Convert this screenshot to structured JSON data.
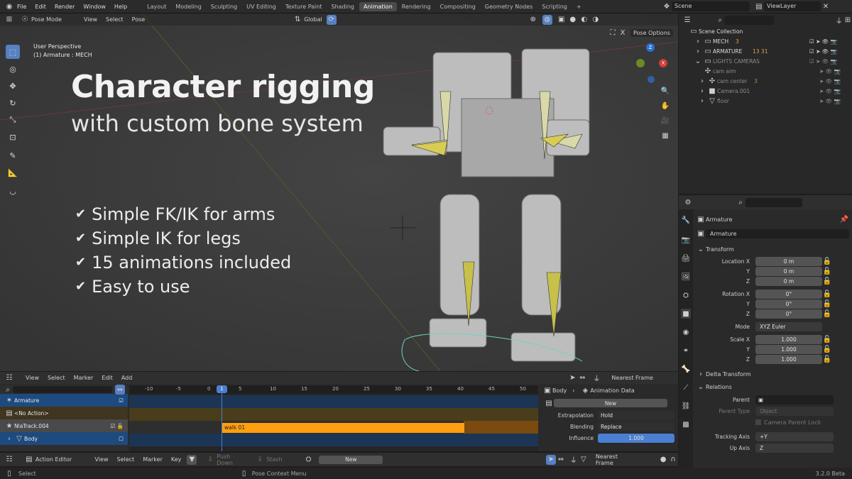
{
  "topbar": {
    "menus": [
      "File",
      "Edit",
      "Render",
      "Window",
      "Help"
    ],
    "workspaces": [
      "Layout",
      "Modeling",
      "Sculpting",
      "UV Editing",
      "Texture Paint",
      "Shading",
      "Animation",
      "Rendering",
      "Compositing",
      "Geometry Nodes",
      "Scripting"
    ],
    "active_workspace": "Animation",
    "scene_label": "Scene",
    "viewlayer_label": "ViewLayer"
  },
  "viewport": {
    "mode": "Pose Mode",
    "menus": [
      "View",
      "Select",
      "Pose"
    ],
    "orientation": "Global",
    "pose_options": "Pose Options",
    "perspective": "User Perspective",
    "object_info": "(1) Armature : MECH",
    "headline": "Character rigging",
    "subheadline": "with custom bone system",
    "features": [
      "Simple FK/IK for arms",
      "Simple IK for legs",
      "15 animations included",
      "Easy to use"
    ],
    "axis_z": "Z",
    "axis_x": "X"
  },
  "outliner": {
    "title": "Scene Collection",
    "items": [
      {
        "name": "MECH",
        "extra": "3",
        "dim": false
      },
      {
        "name": "ARMATURE",
        "extra": "13  31",
        "dim": false
      },
      {
        "name": "LIGHTS CAMERAS",
        "extra": "",
        "dim": true
      },
      {
        "name": "cam aim",
        "extra": "",
        "dim": true
      },
      {
        "name": "cam center",
        "extra": "3",
        "dim": true
      },
      {
        "name": "Camera.001",
        "extra": "",
        "dim": true
      },
      {
        "name": "floor",
        "extra": "",
        "dim": true
      }
    ]
  },
  "properties": {
    "object_name": "Armature",
    "data_name": "Armature",
    "transform_title": "Transform",
    "location": {
      "label": "Location X",
      "x": "0 m",
      "y": "0 m",
      "z": "0 m"
    },
    "rotation": {
      "label": "Rotation X",
      "x": "0°",
      "y": "0°",
      "z": "0°"
    },
    "mode_label": "Mode",
    "mode_value": "XYZ Euler",
    "scale": {
      "label": "Scale X",
      "x": "1.000",
      "y": "1.000",
      "z": "1.000"
    },
    "axis_y": "Y",
    "axis_z": "Z",
    "delta_title": "Delta Transform",
    "relations_title": "Relations",
    "parent_label": "Parent",
    "parent_type_label": "Parent Type",
    "parent_type_value": "Object",
    "camera_parent_lock": "Camera Parent Lock",
    "tracking_axis_label": "Tracking Axis",
    "tracking_axis_value": "+Y",
    "up_axis_label": "Up Axis",
    "up_axis_value": "Z"
  },
  "nla": {
    "menus": [
      "View",
      "Select",
      "Marker",
      "Edit",
      "Add"
    ],
    "snap": "Nearest Frame",
    "frames": [
      "-10",
      "-5",
      "0",
      "5",
      "10",
      "15",
      "20",
      "25",
      "30",
      "35",
      "40",
      "45",
      "50"
    ],
    "current_frame": "1",
    "tracks": [
      {
        "name": "Armature",
        "kind": "object"
      },
      {
        "name": "<No Action>",
        "kind": "action"
      },
      {
        "name": "NlaTrack.004",
        "kind": "track"
      },
      {
        "name": "Body",
        "kind": "object"
      }
    ],
    "strip_name": "walk 01",
    "side": {
      "path_body": "Body",
      "path_anim": "Animation Data",
      "new_label": "New",
      "extrapolation_label": "Extrapolation",
      "extrapolation_value": "Hold",
      "blending_label": "Blending",
      "blending_value": "Replace",
      "influence_label": "Influence",
      "influence_value": "1.000"
    }
  },
  "action_editor": {
    "mode": "Action Editor",
    "menus": [
      "View",
      "Select",
      "Marker",
      "Key"
    ],
    "push_down": "Push Down",
    "stash": "Stash",
    "new_label": "New",
    "snap": "Nearest Frame"
  },
  "status": {
    "select": "Select",
    "context": "Pose Context Menu",
    "version": "3.2.0 Beta"
  },
  "colors": {
    "accent": "#5680c2",
    "strip": "#ff9f10",
    "track_bg": "#1d4a7f",
    "frame_marker": "#4a7fd1"
  }
}
